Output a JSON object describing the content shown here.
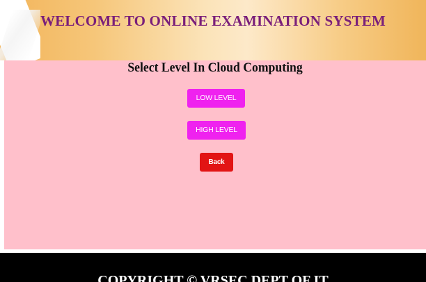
{
  "header": {
    "title": "WELCOME TO ONLINE EXAMINATION SYSTEM"
  },
  "main": {
    "title": "Select Level In Cloud Computing",
    "buttons": {
      "low_level": "LOW LEVEL",
      "high_level": "HIGH LEVEL",
      "back": "Back"
    }
  },
  "footer": {
    "text": "COPYRIGHT © VRSEC DEPT OF IT"
  },
  "colors": {
    "header_gradient_edge": "#f2b45a",
    "header_gradient_center": "#fde9c9",
    "header_title": "#7a1f7a",
    "content_background": "#ffc0cb",
    "level_button": "#ef22ef",
    "back_button": "#e21414",
    "footer_background": "#000000"
  }
}
